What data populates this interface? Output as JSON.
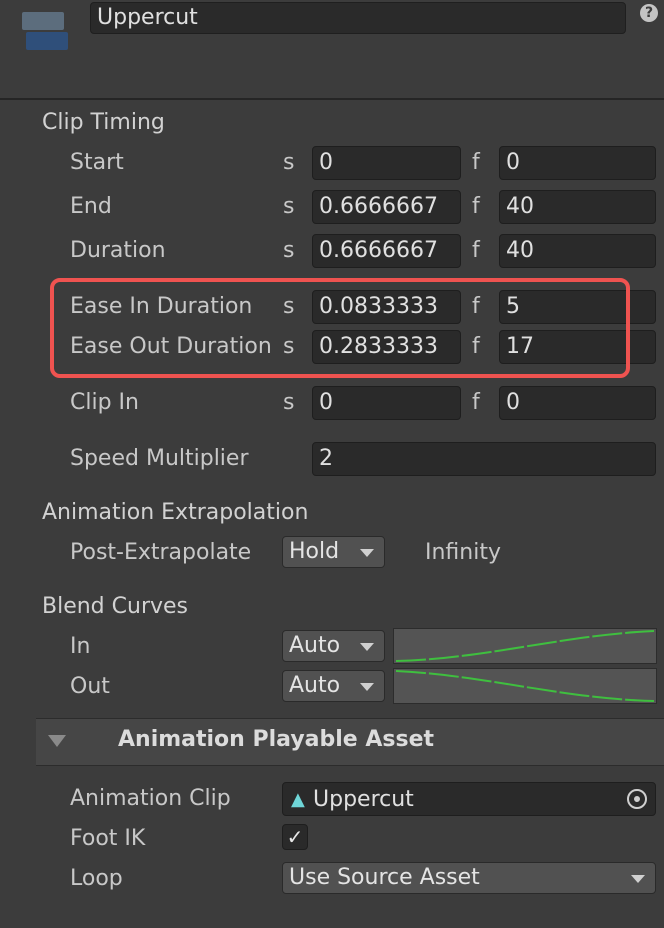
{
  "header": {
    "clip_name": "Uppercut",
    "help_glyph": "?"
  },
  "clip_timing": {
    "title": "Clip Timing",
    "unit_s": "s",
    "unit_f": "f",
    "rows": [
      {
        "label": "Start",
        "s": "0",
        "f": "0"
      },
      {
        "label": "End",
        "s": "0.6666667",
        "f": "40"
      },
      {
        "label": "Duration",
        "s": "0.6666667",
        "f": "40"
      },
      {
        "label": "Ease In Duration",
        "s": "0.0833333",
        "f": "5"
      },
      {
        "label": "Ease Out Duration",
        "s": "0.2833333",
        "f": "17"
      },
      {
        "label": "Clip In",
        "s": "0",
        "f": "0"
      }
    ],
    "speed_label": "Speed Multiplier",
    "speed_value": "2"
  },
  "extrapolation": {
    "title": "Animation Extrapolation",
    "post_label": "Post-Extrapolate",
    "post_value": "Hold",
    "post_infinity": "Infinity"
  },
  "blend_curves": {
    "title": "Blend Curves",
    "in_label": "In",
    "in_value": "Auto",
    "out_label": "Out",
    "out_value": "Auto"
  },
  "asset": {
    "title": "Animation Playable Asset",
    "clip_label": "Animation Clip",
    "clip_value": "Uppercut",
    "clip_icon": "animation-clip-icon",
    "foot_ik_label": "Foot IK",
    "foot_ik_checked": true,
    "loop_label": "Loop",
    "loop_value": "Use Source Asset"
  },
  "colors": {
    "highlight": "#ef5350",
    "curve_line": "#3fbf3f",
    "panel_bg": "#3c3c3c"
  }
}
